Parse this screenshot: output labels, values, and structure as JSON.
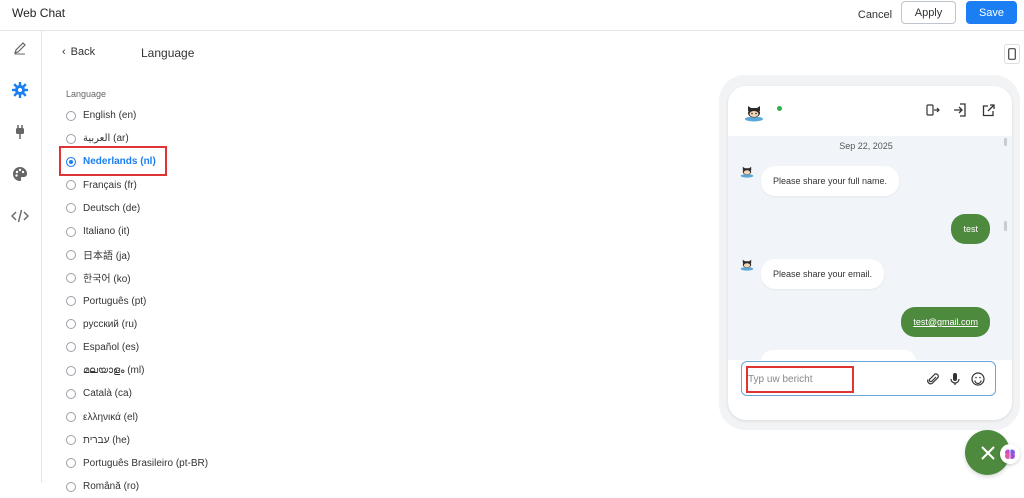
{
  "app": {
    "title": "Web Chat"
  },
  "toolbar": {
    "cancel_label": "Cancel",
    "apply_label": "Apply",
    "save_label": "Save"
  },
  "rail": {
    "icons": [
      "pencil-icon",
      "gear-icon",
      "plug-icon",
      "palette-icon",
      "code-icon"
    ],
    "active": "gear-icon"
  },
  "main": {
    "back_label": "Back",
    "page_title": "Language",
    "section_label": "Language",
    "languages": [
      {
        "label": "English (en)",
        "selected": false
      },
      {
        "label": "العربية (ar)",
        "selected": false
      },
      {
        "label": "Nederlands (nl)",
        "selected": true
      },
      {
        "label": "Français (fr)",
        "selected": false
      },
      {
        "label": "Deutsch (de)",
        "selected": false
      },
      {
        "label": "Italiano (it)",
        "selected": false
      },
      {
        "label": "日本語 (ja)",
        "selected": false
      },
      {
        "label": "한국어 (ko)",
        "selected": false
      },
      {
        "label": "Português (pt)",
        "selected": false
      },
      {
        "label": "русский (ru)",
        "selected": false
      },
      {
        "label": "Español (es)",
        "selected": false
      },
      {
        "label": "മലയാളം (ml)",
        "selected": false
      },
      {
        "label": "Català (ca)",
        "selected": false
      },
      {
        "label": "ελληνικά (el)",
        "selected": false
      },
      {
        "label": "עברית (he)",
        "selected": false
      },
      {
        "label": "Português Brasileiro (pt-BR)",
        "selected": false
      },
      {
        "label": "Română (ro)",
        "selected": false
      }
    ]
  },
  "chat": {
    "date": "Sep 22, 2025",
    "messages": [
      {
        "from": "bot",
        "text": "Please share your full name."
      },
      {
        "from": "user",
        "text": "test"
      },
      {
        "from": "bot",
        "text": "Please share your email."
      },
      {
        "from": "user",
        "text": "test@gmail.com"
      }
    ],
    "input_placeholder": "Typ uw bericht"
  },
  "colors": {
    "accent": "#1b7ef2",
    "user_bubble": "#4e8a3e",
    "highlight": "#e03434"
  }
}
